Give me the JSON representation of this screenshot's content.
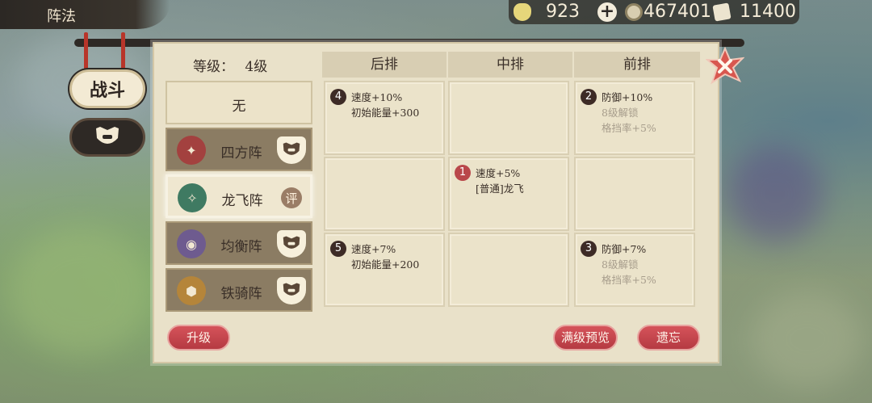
{
  "window": {
    "title": "阵法"
  },
  "resources": {
    "ingot": "923",
    "coins": "467401",
    "tickets": "11400"
  },
  "side_tabs": {
    "battle": "战斗"
  },
  "panel": {
    "level_label": "等级：",
    "level_value": "4级",
    "columns": [
      "后排",
      "中排",
      "前排"
    ],
    "formations": [
      {
        "name": "无"
      },
      {
        "name": "四方阵"
      },
      {
        "name": "龙飞阵",
        "badge": "评"
      },
      {
        "name": "均衡阵"
      },
      {
        "name": "铁骑阵"
      }
    ],
    "slots": {
      "s4": {
        "num": "4",
        "line1": "速度+10%",
        "line2": "初始能量+300"
      },
      "s2": {
        "num": "2",
        "line1": "防御+10%",
        "line2": "8级解锁",
        "line3": "格挡率+5%"
      },
      "s1": {
        "num": "1",
        "line1": "速度+5%",
        "line2": "[普通]龙飞"
      },
      "s5": {
        "num": "5",
        "line1": "速度+7%",
        "line2": "初始能量+200"
      },
      "s3": {
        "num": "3",
        "line1": "防御+7%",
        "line2": "8级解锁",
        "line3": "格挡率+5%"
      }
    },
    "buttons": {
      "upgrade": "升级",
      "preview": "满级预览",
      "forget": "遗忘"
    }
  },
  "colors": {
    "accent_red": "#c0464c",
    "panel_bg": "#e9e1c9",
    "dark": "#2e2925"
  },
  "icons": [
    "ingot-icon",
    "plus-icon",
    "coin-icon",
    "ticket-icon",
    "close-icon",
    "helmet-icon"
  ]
}
